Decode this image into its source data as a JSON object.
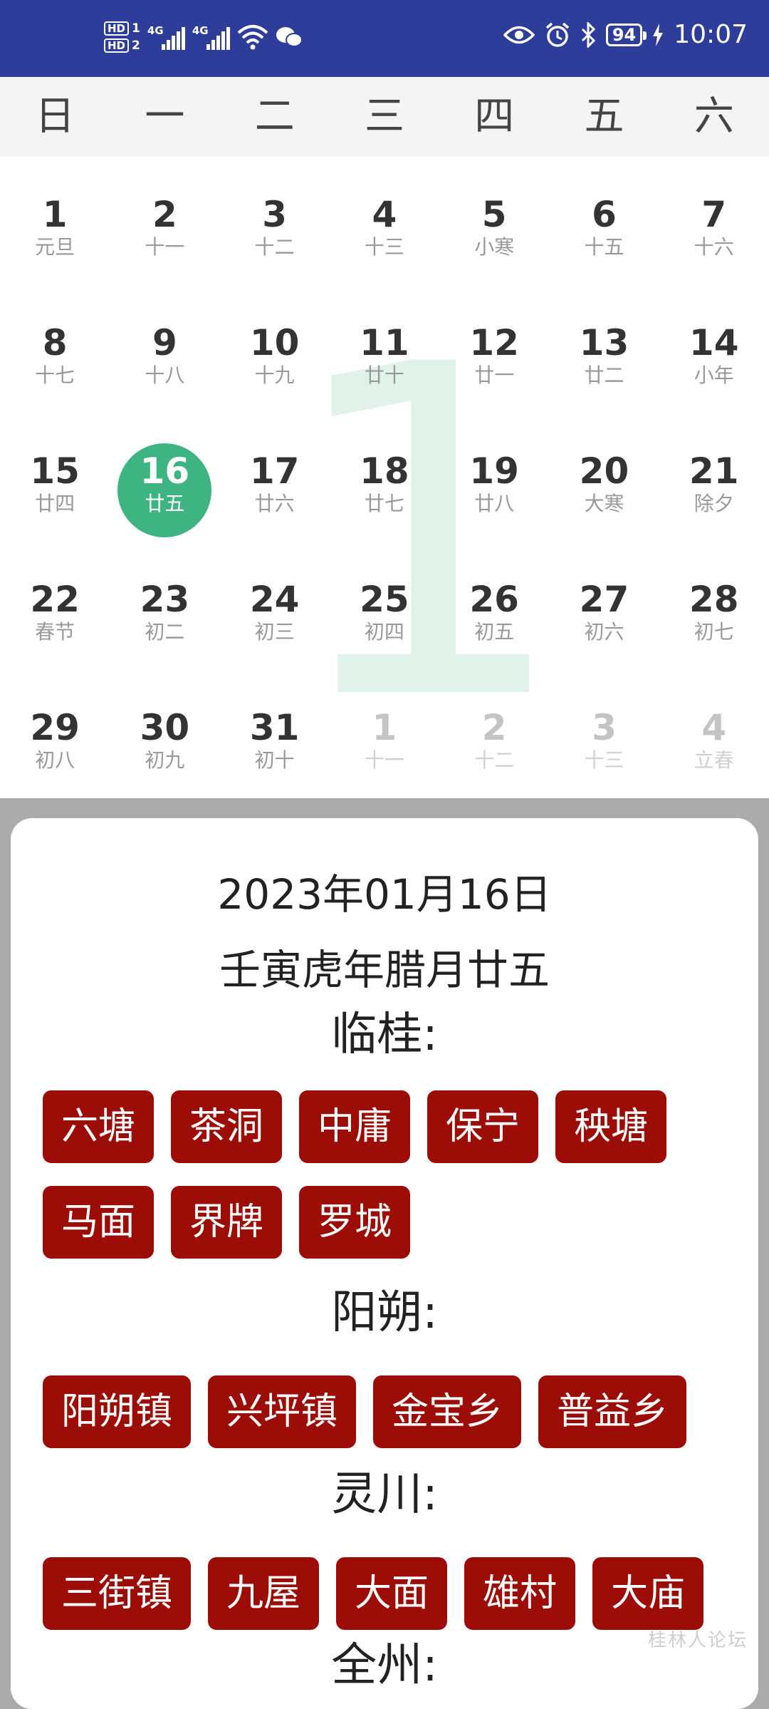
{
  "status_bar": {
    "hd1": "HD",
    "hd1_num": "1",
    "hd2": "HD",
    "hd2_num": "2",
    "net1": "4G",
    "net2": "4G",
    "battery": "94",
    "time": "10:07"
  },
  "weekdays": [
    "日",
    "一",
    "二",
    "三",
    "四",
    "五",
    "六"
  ],
  "month_watermark": "1",
  "days": [
    {
      "n": "1",
      "l": "元旦"
    },
    {
      "n": "2",
      "l": "十一"
    },
    {
      "n": "3",
      "l": "十二"
    },
    {
      "n": "4",
      "l": "十三"
    },
    {
      "n": "5",
      "l": "小寒"
    },
    {
      "n": "6",
      "l": "十五"
    },
    {
      "n": "7",
      "l": "十六"
    },
    {
      "n": "8",
      "l": "十七"
    },
    {
      "n": "9",
      "l": "十八"
    },
    {
      "n": "10",
      "l": "十九"
    },
    {
      "n": "11",
      "l": "廿十"
    },
    {
      "n": "12",
      "l": "廿一"
    },
    {
      "n": "13",
      "l": "廿二"
    },
    {
      "n": "14",
      "l": "小年"
    },
    {
      "n": "15",
      "l": "廿四"
    },
    {
      "n": "16",
      "l": "廿五",
      "selected": true
    },
    {
      "n": "17",
      "l": "廿六"
    },
    {
      "n": "18",
      "l": "廿七"
    },
    {
      "n": "19",
      "l": "廿八"
    },
    {
      "n": "20",
      "l": "大寒"
    },
    {
      "n": "21",
      "l": "除夕"
    },
    {
      "n": "22",
      "l": "春节"
    },
    {
      "n": "23",
      "l": "初二"
    },
    {
      "n": "24",
      "l": "初三"
    },
    {
      "n": "25",
      "l": "初四"
    },
    {
      "n": "26",
      "l": "初五"
    },
    {
      "n": "27",
      "l": "初六"
    },
    {
      "n": "28",
      "l": "初七"
    },
    {
      "n": "29",
      "l": "初八"
    },
    {
      "n": "30",
      "l": "初九"
    },
    {
      "n": "31",
      "l": "初十"
    },
    {
      "n": "1",
      "l": "十一",
      "dim": true
    },
    {
      "n": "2",
      "l": "十二",
      "dim": true
    },
    {
      "n": "3",
      "l": "十三",
      "dim": true
    },
    {
      "n": "4",
      "l": "立春",
      "dim": true
    }
  ],
  "detail": {
    "date": "2023年01月16日",
    "lunar": "壬寅虎年腊月廿五",
    "regions": [
      {
        "name": "临桂:",
        "towns": [
          "六塘",
          "茶洞",
          "中庸",
          "保宁",
          "秧塘",
          "马面",
          "界牌",
          "罗城"
        ]
      },
      {
        "name": "阳朔:",
        "towns": [
          "阳朔镇",
          "兴坪镇",
          "金宝乡",
          "普益乡"
        ]
      },
      {
        "name": "灵川:",
        "towns": [
          "三街镇",
          "九屋",
          "大面",
          "雄村",
          "大庙"
        ]
      },
      {
        "name": "全州:",
        "towns": []
      }
    ]
  },
  "watermark": "桂林人论坛",
  "colors": {
    "status_bar": "#2e3d99",
    "selected": "#3db482",
    "tag": "#9b0d06"
  }
}
